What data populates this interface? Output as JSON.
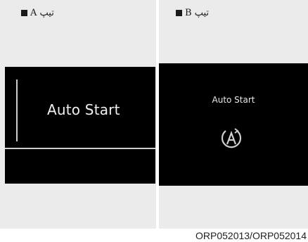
{
  "panels": [
    {
      "type_label": "تیپ A",
      "screen_text": "Auto Start"
    },
    {
      "type_label": "تیپ B",
      "screen_text": "Auto Start",
      "icon": "auto-start-icon"
    }
  ],
  "caption": "ORP052013/ORP052014"
}
